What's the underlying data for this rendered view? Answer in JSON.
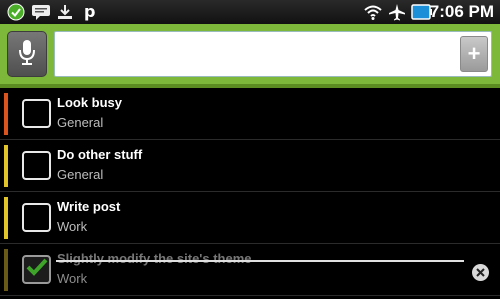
{
  "status_bar": {
    "time": "7:06 PM",
    "icons": [
      "check-circle-icon",
      "chat-icon",
      "usb-download-icon",
      "p-app-icon",
      "wifi-icon",
      "airplane-icon",
      "battery-icon"
    ]
  },
  "entry": {
    "value": "",
    "placeholder": "",
    "add_label": "+"
  },
  "tasks": [
    {
      "title": "Look busy",
      "category": "General",
      "priority_color": "#d9541e",
      "done": false
    },
    {
      "title": "Do other stuff",
      "category": "General",
      "priority_color": "#e0c42a",
      "done": false
    },
    {
      "title": "Write post",
      "category": "Work",
      "priority_color": "#e0c42a",
      "done": false
    },
    {
      "title": "Slightly modify the site's theme",
      "category": "Work",
      "priority_color": "#6a5a18",
      "done": true
    }
  ],
  "colors": {
    "accent_green": "#7db83a",
    "check_green": "#3fa52a"
  }
}
